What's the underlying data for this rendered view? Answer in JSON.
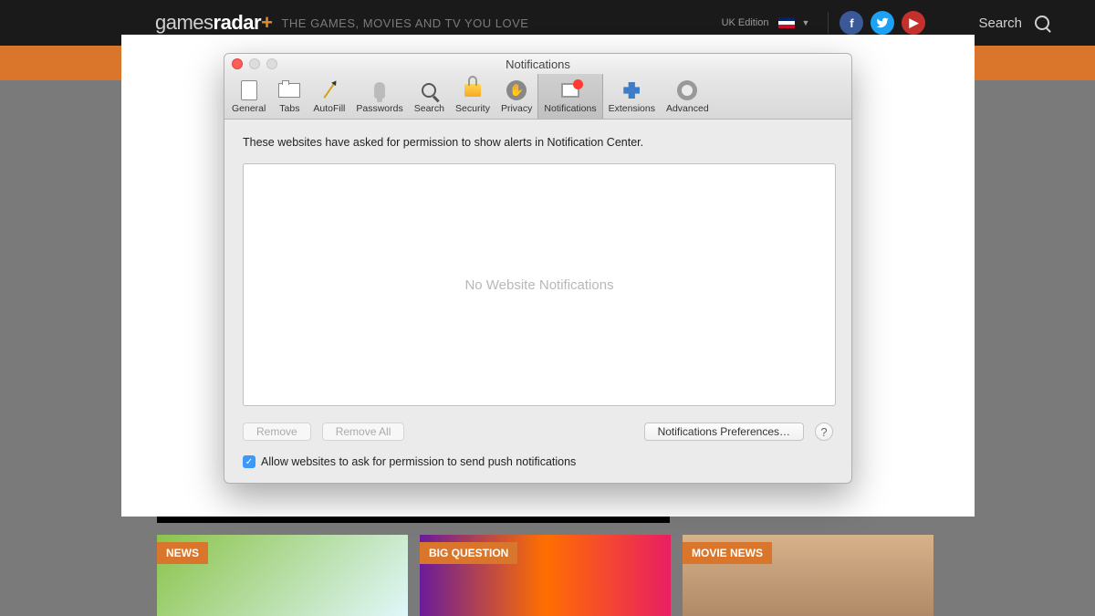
{
  "header": {
    "logo_prefix": "games",
    "logo_suffix": "radar",
    "logo_plus": "+",
    "tagline": "THE GAMES, MOVIES AND TV YOU LOVE",
    "edition": "UK Edition",
    "search_label": "Search"
  },
  "prefs": {
    "title": "Notifications",
    "tabs": [
      {
        "label": "General"
      },
      {
        "label": "Tabs"
      },
      {
        "label": "AutoFill"
      },
      {
        "label": "Passwords"
      },
      {
        "label": "Search"
      },
      {
        "label": "Security"
      },
      {
        "label": "Privacy"
      },
      {
        "label": "Notifications"
      },
      {
        "label": "Extensions"
      },
      {
        "label": "Advanced"
      }
    ],
    "description": "These websites have asked for permission to show alerts in Notification Center.",
    "placeholder": "No Website Notifications",
    "remove_label": "Remove",
    "remove_all_label": "Remove All",
    "prefs_btn_label": "Notifications Preferences…",
    "help_label": "?",
    "checkbox_label": "Allow websites to ask for permission to send push notifications",
    "checkbox_checked": true
  },
  "cards": [
    {
      "badge": "NEWS"
    },
    {
      "badge": "BIG QUESTION"
    },
    {
      "badge": "MOVIE NEWS"
    }
  ]
}
